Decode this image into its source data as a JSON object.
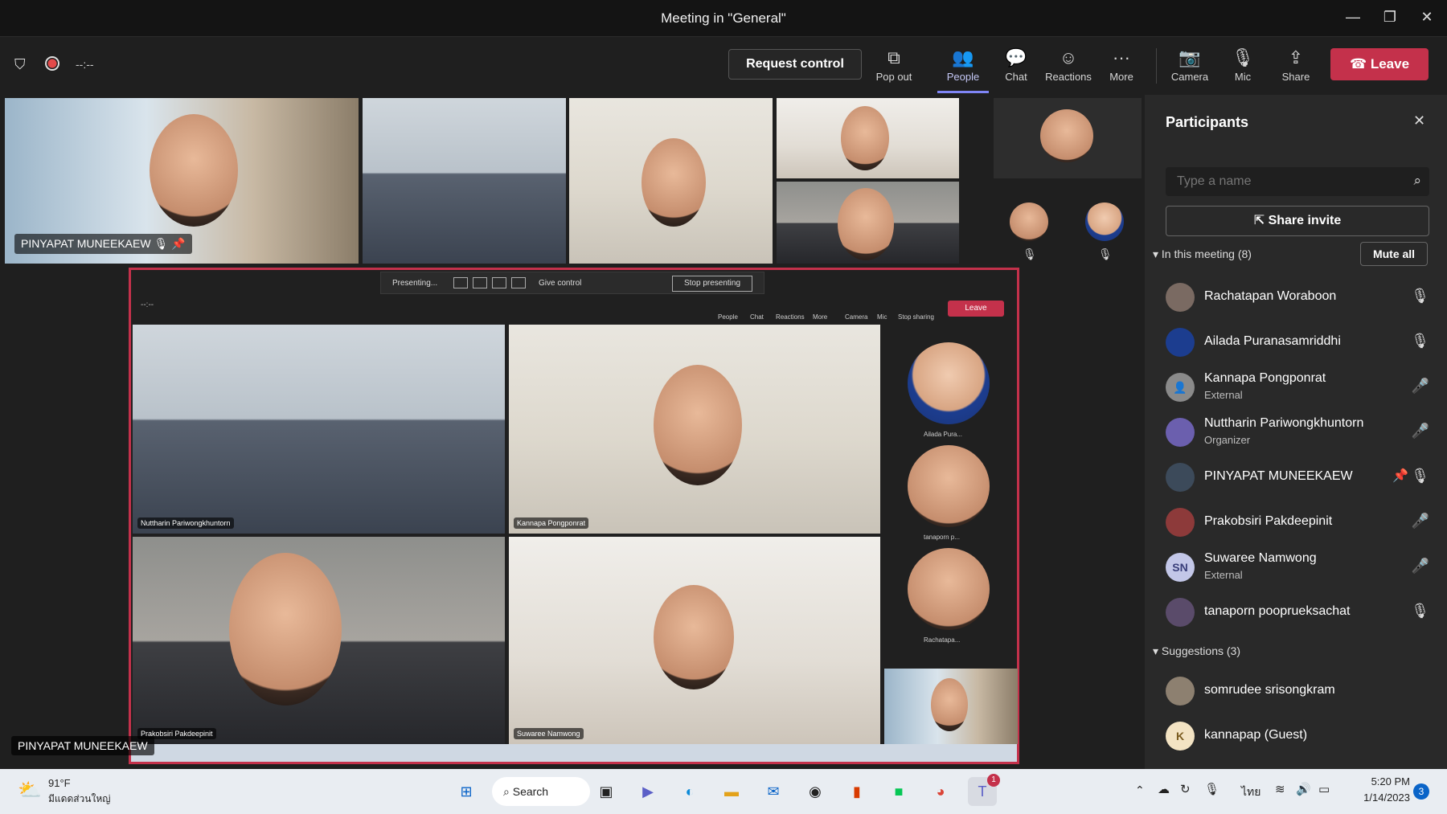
{
  "window": {
    "title": "Meeting in \"General\"",
    "minimize": "—",
    "restore": "❐",
    "close": "✕"
  },
  "toolbar": {
    "timer": "--:--",
    "request_control": "Request control",
    "pop_out": "Pop out",
    "people": "People",
    "chat": "Chat",
    "reactions": "Reactions",
    "more": "More",
    "camera": "Camera",
    "mic": "Mic",
    "share": "Share",
    "leave": "Leave"
  },
  "tiles": {
    "main_speaker": "PINYAPAT MUNEEKAEW",
    "bottom_label": "PINYAPAT MUNEEKAEW"
  },
  "shared_screen": {
    "presenting": "Presenting...",
    "give_control": "Give control",
    "stop_presenting": "Stop presenting",
    "timer": "--:--",
    "people": "People",
    "chat": "Chat",
    "reactions": "Reactions",
    "more": "More",
    "camera": "Camera",
    "mic": "Mic",
    "stop_sharing": "Stop sharing",
    "leave": "Leave",
    "tile1": "Nuttharin Pariwongkhuntorn",
    "tile2": "Kannapa Pongponrat",
    "tile3": "Prakobsiri Pakdeepinit",
    "tile4": "Suwaree Namwong",
    "side1": "Ailada Pura...",
    "side2": "tanaporn p...",
    "side3": "Rachatapa..."
  },
  "participants": {
    "title": "Participants",
    "search_placeholder": "Type a name",
    "share_invite": "Share invite",
    "in_meeting": "In this meeting (8)",
    "mute_all": "Mute all",
    "list": [
      {
        "name": "Rachatapan Woraboon",
        "sub": ""
      },
      {
        "name": "Ailada Puranasamriddhi",
        "sub": ""
      },
      {
        "name": "Kannapa Pongponrat",
        "sub": "External"
      },
      {
        "name": "Nuttharin Pariwongkhuntorn",
        "sub": "Organizer"
      },
      {
        "name": "PINYAPAT MUNEEKAEW",
        "sub": ""
      },
      {
        "name": "Prakobsiri Pakdeepinit",
        "sub": ""
      },
      {
        "name": "Suwaree Namwong",
        "sub": "External",
        "initials": "SN"
      },
      {
        "name": "tanaporn pooprueksachat",
        "sub": ""
      }
    ],
    "suggestions": "Suggestions (3)",
    "suggest_list": [
      {
        "name": "somrudee srisongkram"
      },
      {
        "name": "kannapap (Guest)",
        "initials": "K"
      }
    ]
  },
  "taskbar": {
    "temp": "91°F",
    "location": "มีแดดส่วนใหญ่",
    "search": "Search",
    "lang": "ไทย",
    "time": "5:20 PM",
    "date": "1/14/2023",
    "notif": "3",
    "teams_badge": "1"
  },
  "colors": {
    "leave": "#c4314b",
    "accent": "#7f85f5"
  }
}
